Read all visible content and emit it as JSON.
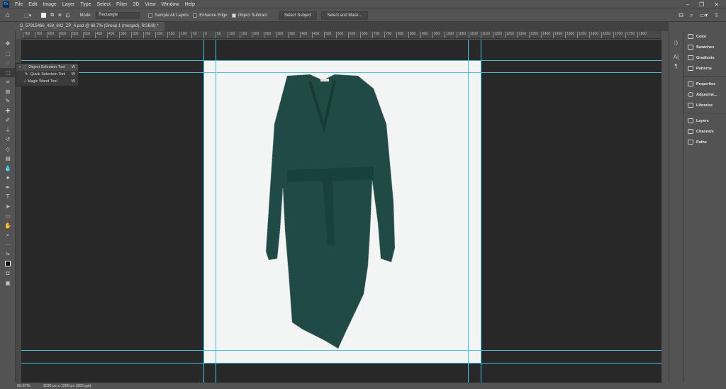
{
  "app": {
    "logo": "Ps"
  },
  "menu": [
    "File",
    "Edit",
    "Image",
    "Layer",
    "Type",
    "Select",
    "Filter",
    "3D",
    "View",
    "Window",
    "Help"
  ],
  "options": {
    "mode_label": "Mode:",
    "mode_value": "Rectangle",
    "sample_all_layers": {
      "label": "Sample All Layers",
      "checked": false
    },
    "enhance_edge": {
      "label": "Enhance Edge",
      "checked": false
    },
    "object_subtract": {
      "label": "Object Subtract",
      "checked": true
    },
    "select_subject": "Select Subject",
    "select_and_mask": "Select and Mask..."
  },
  "document": {
    "tab_title": "G_57915466_459_802_ZP_4.psd @ 66.7% (Group 1 (merged), RGB/8) *",
    "close": "×"
  },
  "ruler_labels": [
    "750",
    "700",
    "650",
    "600",
    "550",
    "500",
    "450",
    "400",
    "350",
    "300",
    "250",
    "200",
    "150",
    "100",
    "50",
    "0",
    "50",
    "100",
    "150",
    "200",
    "250",
    "300",
    "350",
    "400",
    "450",
    "500",
    "550",
    "600",
    "650",
    "700",
    "750",
    "800",
    "850",
    "900",
    "950",
    "1000",
    "1050",
    "1100",
    "1150",
    "1200",
    "1250",
    "1300",
    "1350",
    "1400",
    "1450",
    "1500",
    "1550",
    "1600",
    "1650",
    "1700",
    "1750",
    "1800"
  ],
  "flyout": [
    {
      "label": "Object Selection Tool",
      "key": "W",
      "active": true
    },
    {
      "label": "Quick Selection Tool",
      "key": "W",
      "active": false
    },
    {
      "label": "Magic Wand Tool",
      "key": "W",
      "active": false
    }
  ],
  "panels": {
    "group1": [
      "Color",
      "Swatches",
      "Gradients",
      "Patterns"
    ],
    "group2": [
      "Properties",
      "Adjustme...",
      "Libraries"
    ],
    "group3": [
      "Layers",
      "Channels",
      "Paths"
    ]
  },
  "status": {
    "zoom": "66.67%",
    "info": "1100 px x 1200 px (300 ppi)"
  },
  "colors": {
    "garment": "#1f4a45",
    "guide": "#3ec6dc",
    "canvas_bg": "#282828"
  }
}
